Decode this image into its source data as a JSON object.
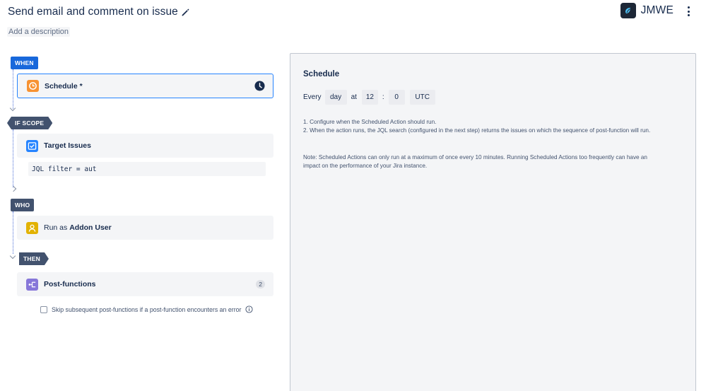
{
  "header": {
    "title": "Send email and comment on issue",
    "description_link": "Add a description",
    "brand_name": "JMWE"
  },
  "flow": {
    "when": {
      "tag": "WHEN",
      "schedule_card": "Schedule *"
    },
    "if_scope": {
      "tag": "IF SCOPE",
      "target_card": "Target Issues",
      "jql": "JQL filter = aut"
    },
    "who": {
      "tag": "WHO",
      "run_as_prefix": "Run as",
      "run_as_user": "Addon User"
    },
    "then": {
      "tag": "THEN",
      "post_functions_card": "Post-functions",
      "post_functions_count": "2",
      "skip_label": "Skip subsequent post-functions if a post-function encounters an error",
      "skip_checked": false
    }
  },
  "schedule_panel": {
    "title": "Schedule",
    "every_label": "Every",
    "period_value": "day",
    "at_label": "at",
    "hour_value": "12",
    "colon": ":",
    "minute_value": "0",
    "timezone": "UTC",
    "help_line_1": "1. Configure when the Scheduled Action should run.",
    "help_line_2": "2. When the action runs, the JQL search (configured in the next step) returns the issues on which the sequence of post-function will run.",
    "note_line_1": "Note: Scheduled Actions can only run at a maximum of once every 10 minutes. Running Scheduled Actions too frequently can have an",
    "note_line_2": "impact on the performance of your Jira instance."
  },
  "colors": {
    "when_tag": "#1868db",
    "dark_tag": "#42526e",
    "selected_border": "#2684ff",
    "schedule_icon": "#f79232",
    "target_icon": "#2684ff",
    "user_icon": "#e2b203",
    "post_icon": "#8777d9"
  },
  "icons": [
    "pencil-icon",
    "jmwe-logo-icon",
    "more-vertical-icon",
    "schedule-icon",
    "clock-icon",
    "target-issues-icon",
    "user-icon",
    "post-functions-icon",
    "info-icon"
  ]
}
